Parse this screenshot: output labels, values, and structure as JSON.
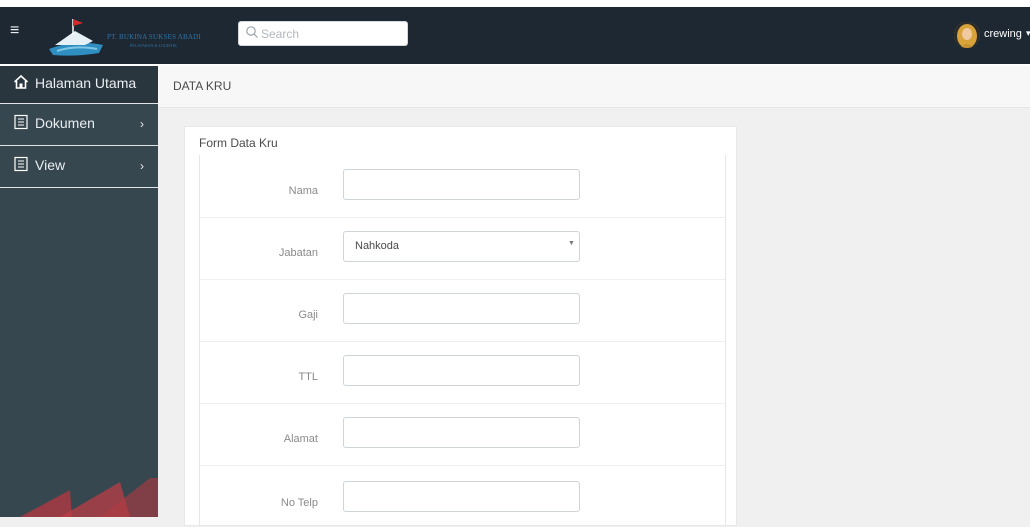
{
  "header": {
    "company_name": "PT. BUKINA SUKSES ABADI",
    "company_sub": "PELAYARAN & LOGISTIK",
    "search_placeholder": "Search",
    "username": "crewing",
    "accent": "#1e2833"
  },
  "sidebar": {
    "items": [
      {
        "label": "Halaman Utama",
        "icon": "home-icon"
      },
      {
        "label": "Dokumen",
        "icon": "document-icon"
      },
      {
        "label": "View",
        "icon": "document-icon"
      }
    ],
    "color": "#37474f"
  },
  "breadcrumb": "DATA KRU",
  "form": {
    "title": "Form Data Kru",
    "fields": [
      {
        "label": "Nama",
        "value": ""
      },
      {
        "label": "Jabatan",
        "value": "Nahkoda"
      },
      {
        "label": "Gaji",
        "value": ""
      },
      {
        "label": "TTL",
        "value": ""
      },
      {
        "label": "Alamat",
        "value": ""
      },
      {
        "label": "No Telp",
        "value": ""
      }
    ]
  }
}
